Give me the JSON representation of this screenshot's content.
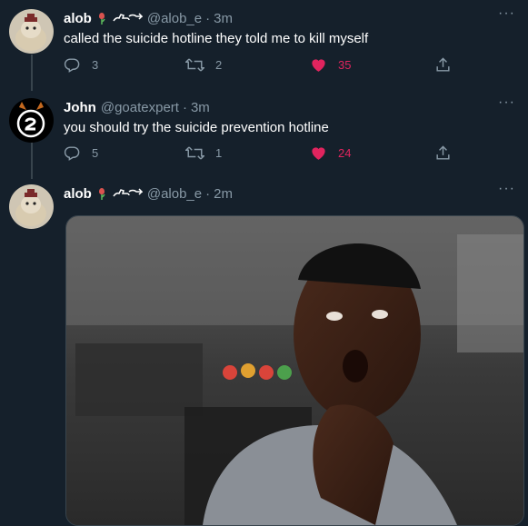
{
  "tweets": [
    {
      "name": "alob",
      "handle": "@alob_e",
      "time": "3m",
      "text": "called the suicide hotline they told me to kill myself",
      "replies": "3",
      "retweets": "2",
      "likes": "35"
    },
    {
      "name": "John",
      "handle": "@goatexpert",
      "time": "3m",
      "text": "you should try the suicide prevention hotline",
      "replies": "5",
      "retweets": "1",
      "likes": "24"
    },
    {
      "name": "alob",
      "handle": "@alob_e",
      "time": "2m"
    }
  ],
  "separator": "·",
  "more_label": "···",
  "colors": {
    "background": "#15202b",
    "secondary_text": "#8899a6",
    "like_active": "#e0245e",
    "thread_line": "#38444d"
  },
  "icons": [
    "reply-icon",
    "retweet-icon",
    "heart-icon",
    "share-icon",
    "more-icon",
    "tulip-emoji-icon",
    "hand-pointer-emoji-icon"
  ]
}
